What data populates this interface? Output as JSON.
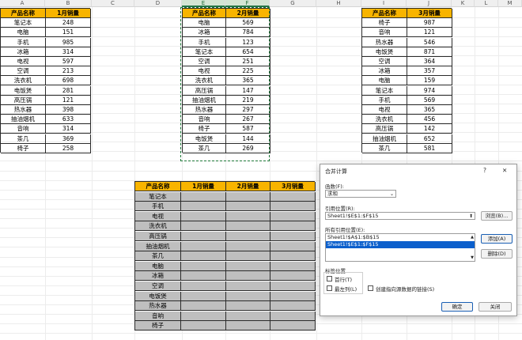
{
  "columns": [
    "A",
    "B",
    "C",
    "D",
    "E",
    "F",
    "G",
    "H",
    "I",
    "J",
    "K",
    "L",
    "M"
  ],
  "table1": {
    "headers": [
      "产品名称",
      "1月销量"
    ],
    "rows": [
      [
        "笔记本",
        "248"
      ],
      [
        "电脑",
        "151"
      ],
      [
        "手机",
        "985"
      ],
      [
        "冰箱",
        "314"
      ],
      [
        "电视",
        "597"
      ],
      [
        "空调",
        "213"
      ],
      [
        "洗衣机",
        "698"
      ],
      [
        "电饭煲",
        "281"
      ],
      [
        "高压锅",
        "121"
      ],
      [
        "热水器",
        "398"
      ],
      [
        "抽油烟机",
        "633"
      ],
      [
        "音响",
        "314"
      ],
      [
        "茶几",
        "369"
      ],
      [
        "椅子",
        "258"
      ]
    ]
  },
  "table2": {
    "headers": [
      "产品名称",
      "2月销量"
    ],
    "rows": [
      [
        "电脑",
        "569"
      ],
      [
        "冰箱",
        "784"
      ],
      [
        "手机",
        "123"
      ],
      [
        "笔记本",
        "654"
      ],
      [
        "空调",
        "251"
      ],
      [
        "电视",
        "225"
      ],
      [
        "洗衣机",
        "365"
      ],
      [
        "高压锅",
        "147"
      ],
      [
        "抽油烟机",
        "219"
      ],
      [
        "热水器",
        "297"
      ],
      [
        "音响",
        "267"
      ],
      [
        "椅子",
        "587"
      ],
      [
        "电饭煲",
        "144"
      ],
      [
        "茶几",
        "269"
      ]
    ]
  },
  "table3": {
    "headers": [
      "产品名称",
      "3月销量"
    ],
    "rows": [
      [
        "椅子",
        "987"
      ],
      [
        "音响",
        "121"
      ],
      [
        "热水器",
        "546"
      ],
      [
        "电饭煲",
        "871"
      ],
      [
        "空调",
        "364"
      ],
      [
        "冰箱",
        "357"
      ],
      [
        "电脑",
        "159"
      ],
      [
        "笔记本",
        "974"
      ],
      [
        "手机",
        "569"
      ],
      [
        "电视",
        "365"
      ],
      [
        "洗衣机",
        "456"
      ],
      [
        "高压锅",
        "142"
      ],
      [
        "抽油烟机",
        "652"
      ],
      [
        "茶几",
        "581"
      ]
    ]
  },
  "summary": {
    "headers": [
      "产品名称",
      "1月销量",
      "2月销量",
      "3月销量"
    ],
    "products": [
      "笔记本",
      "手机",
      "电视",
      "洗衣机",
      "高压锅",
      "抽油烟机",
      "茶几",
      "电脑",
      "冰箱",
      "空调",
      "电饭煲",
      "热水器",
      "音响",
      "椅子"
    ]
  },
  "dialog": {
    "title": "合并计算",
    "help": "?",
    "close": "✕",
    "function_label": "函数(F):",
    "function_value": "求和",
    "ref_label": "引用位置(R):",
    "ref_value": "Sheet1!$E$1:$F$15",
    "browse": "浏览(B)...",
    "all_refs_label": "所有引用位置(E):",
    "all_refs": [
      "Sheet1!$A$1:$B$15",
      "Sheet1!$E$1:$F$15"
    ],
    "add": "添加(A)",
    "delete": "删除(D)",
    "label_pos": "标签位置",
    "top_row": "首行(T)",
    "left_col": "最左列(L)",
    "link_source": "创建指向源数据的链接(S)",
    "ok": "确定",
    "close_btn": "关闭"
  },
  "colors": {
    "header": "#f8b400",
    "grey": "#bfbfbf",
    "selection": "#0b5fcc"
  }
}
